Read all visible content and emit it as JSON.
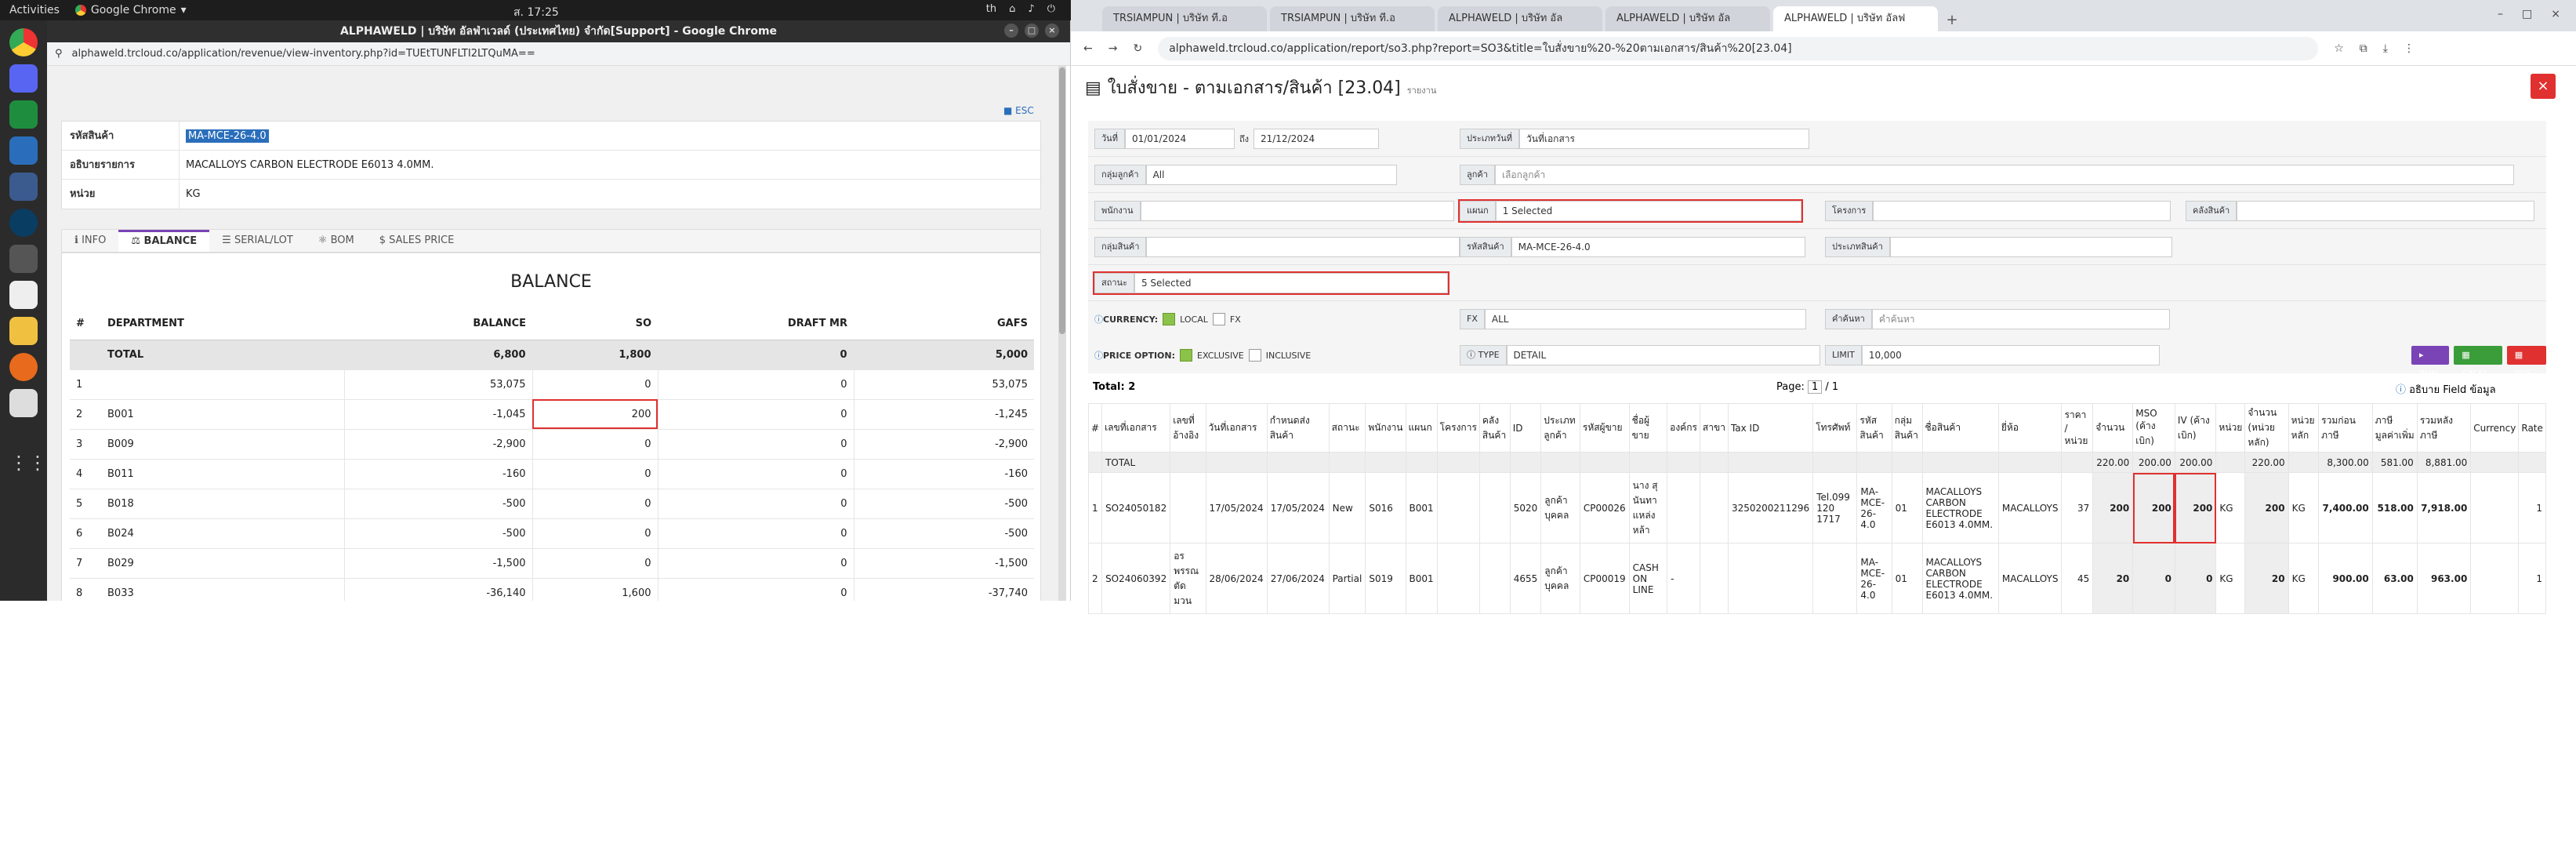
{
  "desktop": {
    "activities": "Activities",
    "app_name": "Google Chrome",
    "clock": "ส. 17:25",
    "tray_lang": "th"
  },
  "left_window": {
    "title": "ALPHAWELD | บริษัท อัลฟ่าเวลด์ (ประเทศไทย) จำกัด[Support] - Google Chrome",
    "url": "alphaweld.trcloud.co/application/revenue/view-inventory.php?id=TUEtTUNFLTI2LTQuMA==",
    "esc": "ESC",
    "info_rows": [
      {
        "label": "รหัสสินค้า",
        "value": "MA-MCE-26-4.0"
      },
      {
        "label": "อธิบายรายการ",
        "value": "MACALLOYS CARBON ELECTRODE E6013 4.0MM."
      },
      {
        "label": "หน่วย",
        "value": "KG"
      }
    ],
    "tabs": [
      "INFO",
      "BALANCE",
      "SERIAL/LOT",
      "BOM",
      "SALES PRICE"
    ],
    "balance_title": "BALANCE",
    "balance_headers": [
      "#",
      "DEPARTMENT",
      "BALANCE",
      "SO",
      "DRAFT MR",
      "GAFS"
    ],
    "balance_rows": [
      {
        "no": "",
        "dept": "TOTAL",
        "balance": "6,800",
        "so": "1,800",
        "mr": "0",
        "gafs": "5,000"
      },
      {
        "no": "1",
        "dept": "",
        "balance": "53,075",
        "so": "0",
        "mr": "0",
        "gafs": "53,075"
      },
      {
        "no": "2",
        "dept": "B001",
        "balance": "-1,045",
        "so": "200",
        "mr": "0",
        "gafs": "-1,245"
      },
      {
        "no": "3",
        "dept": "B009",
        "balance": "-2,900",
        "so": "0",
        "mr": "0",
        "gafs": "-2,900"
      },
      {
        "no": "4",
        "dept": "B011",
        "balance": "-160",
        "so": "0",
        "mr": "0",
        "gafs": "-160"
      },
      {
        "no": "5",
        "dept": "B018",
        "balance": "-500",
        "so": "0",
        "mr": "0",
        "gafs": "-500"
      },
      {
        "no": "6",
        "dept": "B024",
        "balance": "-500",
        "so": "0",
        "mr": "0",
        "gafs": "-500"
      },
      {
        "no": "7",
        "dept": "B029",
        "balance": "-1,500",
        "so": "0",
        "mr": "0",
        "gafs": "-1,500"
      },
      {
        "no": "8",
        "dept": "B033",
        "balance": "-36,140",
        "so": "1,600",
        "mr": "0",
        "gafs": "-37,740"
      }
    ]
  },
  "right_window": {
    "tabs": [
      "TRSIAMPUN | บริษัท ที.อ",
      "TRSIAMPUN | บริษัท ที.อ",
      "ALPHAWELD | บริษัท อัล",
      "ALPHAWELD | บริษัท อัล",
      "ALPHAWELD | บริษัท อัลฟ"
    ],
    "url": "alphaweld.trcloud.co/application/report/so3.php?report=SO3&title=ใบสั่งขาย%20-%20ตามเอกสาร/สินค้า%20[23.04]",
    "page_title": "ใบสั่งขาย - ตามเอกสาร/สินค้า [23.04]",
    "page_sub": "รายงาน",
    "filters": {
      "date_label": "วันที่",
      "date_from": "01/01/2024",
      "date_to_label": "ถึง",
      "date_to": "21/12/2024",
      "date_type_label": "ประเภทวันที่",
      "date_type": "วันที่เอกสาร",
      "cust_group_label": "กลุ่มลูกค้า",
      "cust_group": "All",
      "customer_label": "ลูกค้า",
      "customer_ph": "เลือกลูกค้า",
      "staff_label": "พนักงาน",
      "dept_label": "แผนก",
      "dept_value": "1 Selected",
      "project_label": "โครงการ",
      "warehouse_label": "คลังสินค้า",
      "prod_group_label": "กลุ่มสินค้า",
      "prod_code_label": "รหัสสินค้า",
      "prod_code": "MA-MCE-26-4.0",
      "prod_type_label": "ประเภทสินค้า",
      "status_label": "สถานะ",
      "status_value": "5 Selected",
      "currency_label": "CURRENCY:",
      "local": "LOCAL",
      "fx": "FX",
      "fx_label": "FX",
      "fx_value": "ALL",
      "search_label": "คำค้นหา",
      "search_ph": "คำค้นหา",
      "price_label": "PRICE OPTION:",
      "exclusive": "EXCLUSIVE",
      "inclusive": "INCLUSIVE",
      "type_label": "TYPE",
      "type_value": "DETAIL",
      "limit_label": "LIMIT",
      "limit_value": "10,000",
      "run": "RUN",
      "excel": "EXCEL",
      "pdf": "PDF"
    },
    "total_label": "Total: 2",
    "page_label": "Page:",
    "page_num": "1",
    "page_total": "/ 1",
    "field_desc": "อธิบาย Field ข้อมูล",
    "headers": [
      "#",
      "เลขที่เอกสาร",
      "เลขที่อ้างอิง",
      "วันที่เอกสาร",
      "กำหนดส่งสินค้า",
      "สถานะ",
      "พนักงาน",
      "แผนก",
      "โครงการ",
      "คลังสินค้า",
      "ID",
      "ประเภทลูกค้า",
      "รหัสผู้ขาย",
      "ชื่อผู้ขาย",
      "องค์กร",
      "สาขา",
      "Tax ID",
      "โทรศัพท์",
      "รหัสสินค้า",
      "กลุ่มสินค้า",
      "ชื่อสินค้า",
      "ยี่ห้อ",
      "ราคา / หน่วย",
      "จำนวน",
      "MSO (ค้างเบิก)",
      "IV (ค้างเบิก)",
      "หน่วย",
      "จำนวน (หน่วยหลัก)",
      "หน่วยหลัก",
      "รวมก่อนภาษี",
      "ภาษีมูลค่าเพิ่ม",
      "รวมหลังภาษี",
      "Currency",
      "Rate"
    ],
    "total_row": {
      "label": "TOTAL",
      "qty": "220.00",
      "mso": "200.00",
      "iv": "200.00",
      "qty_main": "220.00",
      "pre_tax": "8,300.00",
      "vat": "581.00",
      "post_tax": "8,881.00"
    },
    "rows": [
      {
        "no": "1",
        "doc": "SO24050182",
        "ref": "",
        "date": "17/05/2024",
        "due": "17/05/2024",
        "status": "New",
        "staff": "S016",
        "dept": "B001",
        "proj": "",
        "wh": "",
        "id": "5020",
        "ctype": "ลูกค้าบุคคล",
        "vcode": "CP00026",
        "vname": "นาง สุนันทา แหล่งหล้า",
        "org": "",
        "branch": "",
        "tax": "3250200211296",
        "tel": "Tel.099 120 1717",
        "pcode": "MA-MCE-26-4.0",
        "pgroup": "01",
        "pname": "MACALLOYS CARBON ELECTRODE E6013 4.0MM.",
        "brand": "MACALLOYS",
        "price": "37",
        "qty": "200",
        "mso": "200",
        "iv": "200",
        "unit": "KG",
        "qty_main": "200",
        "unit_main": "KG",
        "pre": "7,400.00",
        "vat": "518.00",
        "post": "7,918.00",
        "cur": "",
        "rate": "1"
      },
      {
        "no": "2",
        "doc": "SO24060392",
        "ref": "อร พรรณ ตัดมวน",
        "date": "28/06/2024",
        "due": "27/06/2024",
        "status": "Partial",
        "staff": "S019",
        "dept": "B001",
        "proj": "",
        "wh": "",
        "id": "4655",
        "ctype": "ลูกค้าบุคคล",
        "vcode": "CP00019",
        "vname": "CASH ON LINE",
        "org": "-",
        "branch": "",
        "tax": "",
        "tel": "",
        "pcode": "MA-MCE-26-4.0",
        "pgroup": "01",
        "pname": "MACALLOYS CARBON ELECTRODE E6013 4.0MM.",
        "brand": "MACALLOYS",
        "price": "45",
        "qty": "20",
        "mso": "0",
        "iv": "0",
        "unit": "KG",
        "qty_main": "20",
        "unit_main": "KG",
        "pre": "900.00",
        "vat": "63.00",
        "post": "963.00",
        "cur": "",
        "rate": "1"
      }
    ]
  }
}
